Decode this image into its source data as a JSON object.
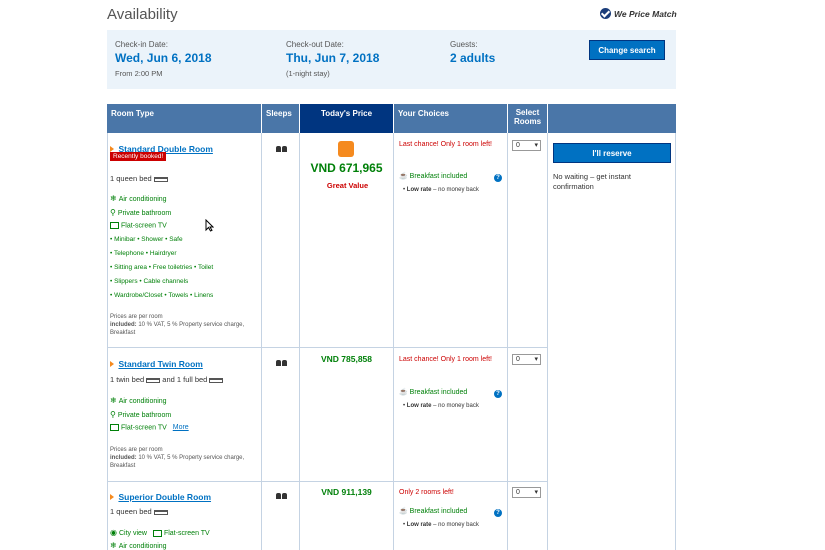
{
  "header": {
    "title": "Availability",
    "price_match": "We Price Match"
  },
  "search": {
    "checkin_label": "Check-in Date:",
    "checkin_value": "Wed, Jun 6, 2018",
    "checkin_sub": "From 2:00 PM",
    "checkout_label": "Check-out Date:",
    "checkout_value": "Thu, Jun 7, 2018",
    "checkout_sub": "(1-night stay)",
    "guests_label": "Guests:",
    "guests_value": "2 adults",
    "change_button": "Change search"
  },
  "table": {
    "headers": {
      "room_type": "Room Type",
      "sleeps": "Sleeps",
      "price": "Today's Price",
      "choices": "Your Choices",
      "select": "Select Rooms"
    }
  },
  "reserve": {
    "button": "I'll reserve",
    "note": "No waiting – get instant confirmation"
  },
  "rooms": [
    {
      "name": "Standard Double Room",
      "badge": "Recently booked!",
      "bed": "1 queen bed",
      "features": [
        "Air conditioning",
        "Private bathroom",
        "Flat-screen TV"
      ],
      "facilities": [
        "• Minibar  • Shower  • Safe",
        "• Telephone  • Hairdryer",
        "• Sitting area  • Free toiletries  • Toilet",
        "• Slippers  • Cable channels",
        "• Wardrobe/Closet  • Towels  • Linens"
      ],
      "price_note": "Prices are per room",
      "included_label": "included:",
      "included": "10 % VAT, 5 % Property service charge, Breakfast",
      "price": "VND 671,965",
      "deal": "Great Value",
      "availability": "Last chance! Only 1 room left!",
      "breakfast": "Breakfast included",
      "low_rate_label": "Low rate",
      "low_rate": " – no money back",
      "select": "0"
    },
    {
      "name": "Standard Twin Room",
      "bed": "1 twin bed",
      "bed2": "and 1 full bed",
      "features": [
        "Air conditioning",
        "Private bathroom",
        "Flat-screen TV"
      ],
      "more": "More",
      "price_note": "Prices are per room",
      "included_label": "included:",
      "included": "10 % VAT, 5 % Property service charge, Breakfast",
      "price": "VND 785,858",
      "availability": "Last chance! Only 1 room left!",
      "breakfast": "Breakfast included",
      "low_rate_label": "Low rate",
      "low_rate": " – no money back",
      "select": "0"
    },
    {
      "name": "Superior Double Room",
      "bed": "1 queen bed",
      "features": [
        "City view",
        "Flat-screen TV",
        "Air conditioning"
      ],
      "price": "VND 911,139",
      "availability": "Only 2 rooms left!",
      "breakfast": "Breakfast included",
      "low_rate_label": "Low rate",
      "low_rate": " – no money back",
      "select": "0"
    }
  ]
}
